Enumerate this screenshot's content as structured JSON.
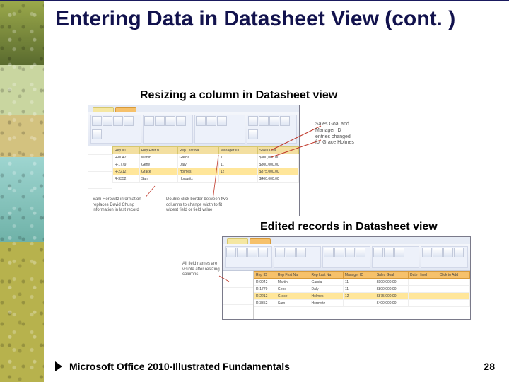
{
  "title": "Entering Data in Datasheet View (cont. )",
  "caption1": "Resizing a column in Datasheet view",
  "caption2": "Edited records in Datasheet view",
  "side_callout": "Sales Goal and Manager ID entries changed for Grace Holmes",
  "fig1": {
    "callout_left": "Sam Horowitz information replaces David Chung information in last record",
    "callout_right": "Double-click border between two columns to change width to fit widest field or field value",
    "headers": [
      "Rep ID",
      "Rep First N",
      "Rep Last Na",
      "Manager ID"
    ],
    "rows": [
      [
        "R-0042",
        "Martin",
        "Garcia",
        "11"
      ],
      [
        "R-1779",
        "Gene",
        "Daly",
        "11"
      ],
      [
        "R-2212",
        "Grace",
        "Holmes",
        "12"
      ],
      [
        "R-3352",
        "Sam",
        "Horowitz",
        ""
      ]
    ],
    "side_col_header": "Sales Goal",
    "side_col_values": [
      "$900,000.00",
      "$800,000.00",
      "$875,000.00",
      "$400,000.00"
    ]
  },
  "fig2": {
    "left_callout": "All field names are visible after resizing columns",
    "headers": [
      "Rep ID",
      "Rep First Na",
      "Rep Last Na",
      "Manager ID",
      "Sales Goal",
      "Date Hired",
      "Click to Add"
    ],
    "rows": [
      [
        "R-0042",
        "Martin",
        "Garcia",
        "11",
        "$900,000.00",
        "",
        ""
      ],
      [
        "R-1779",
        "Gene",
        "Daly",
        "11",
        "$800,000.00",
        "",
        ""
      ],
      [
        "R-2212",
        "Grace",
        "Holmes",
        "12",
        "$875,000.00",
        "",
        ""
      ],
      [
        "R-3352",
        "Sam",
        "Horowitz",
        "",
        "$400,000.00",
        "",
        ""
      ]
    ]
  },
  "footer_text": "Microsoft Office 2010-Illustrated Fundamentals",
  "page_number": "28"
}
